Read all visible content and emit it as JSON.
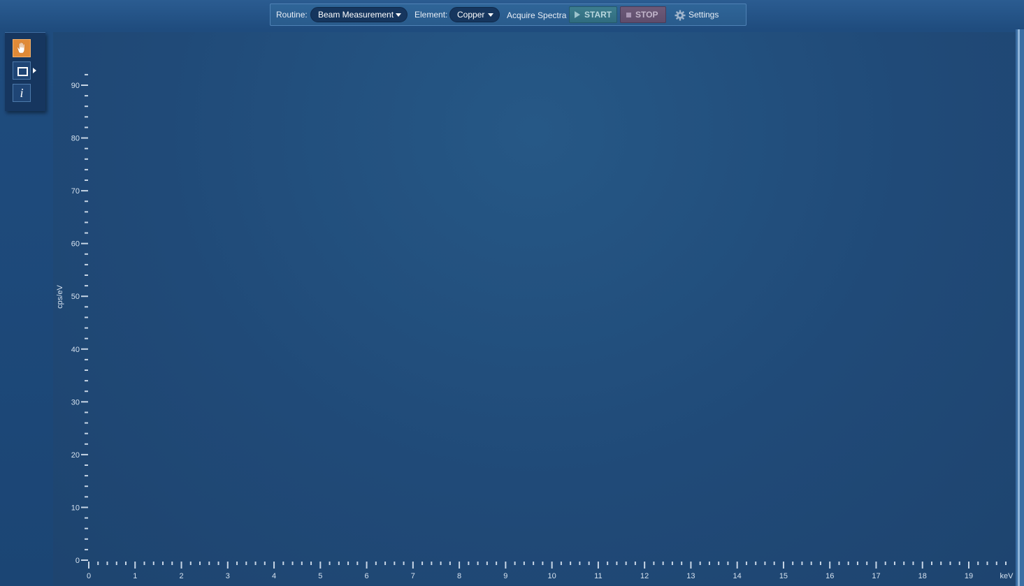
{
  "toolbar": {
    "routine_label": "Routine:",
    "routine_value": "Beam Measurement",
    "element_label": "Element:",
    "element_value": "Copper",
    "acquire_label": "Acquire Spectra",
    "start_label": "START",
    "stop_label": "STOP",
    "settings_label": "Settings"
  },
  "tools": {
    "pan_icon": "hand-icon",
    "rect_icon": "rectangle-select-icon",
    "info_label": "i"
  },
  "colors": {
    "accent_pan_tool": "#e08a37",
    "background": "#1d4371",
    "axis": "#c8d6e6"
  },
  "chart_data": {
    "type": "line",
    "title": "",
    "xlabel": "keV",
    "ylabel": "cps/eV",
    "xlim": [
      0,
      19
    ],
    "ylim": [
      0,
      90
    ],
    "x_ticks": [
      "0",
      "1",
      "2",
      "3",
      "4",
      "5",
      "6",
      "7",
      "8",
      "9",
      "10",
      "11",
      "12",
      "13",
      "14",
      "15",
      "16",
      "17",
      "18",
      "19"
    ],
    "y_ticks": [
      "0",
      "10",
      "20",
      "30",
      "40",
      "50",
      "60",
      "70",
      "80",
      "90"
    ],
    "series": [],
    "grid": false
  }
}
